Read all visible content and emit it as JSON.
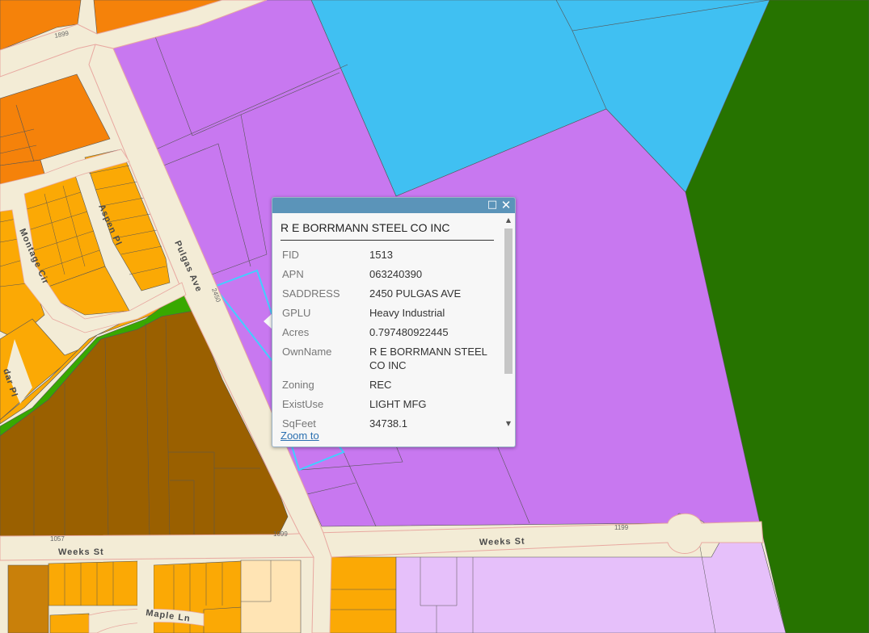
{
  "map": {
    "colors": {
      "purple_industrial": "#c878f0",
      "blue_zone": "#40c0f2",
      "dark_green": "#267300",
      "orange_commercial": "#f5820a",
      "yellow_orange_residential": "#fba905",
      "brown_zone": "#9a6000",
      "lavender_zone": "#e6c0fa",
      "light_tan": "#ffe4b4",
      "road": "#f3ecd6",
      "road_edge": "#e8a8a0",
      "green_strip": "#38a800",
      "selection": "#40d0ff"
    },
    "street_labels": {
      "pulgas_ave": "Pulgas Ave",
      "weeks_st_left": "Weeks St",
      "weeks_st_right": "Weeks St",
      "montage_cir": "Montage Cir",
      "aspen_pl": "Aspen Pl",
      "maple_ln": "Maple Ln",
      "cedar_pl": "dar Pl"
    },
    "address_labels": [
      "1899",
      "1057",
      "1099",
      "1199",
      "2450"
    ]
  },
  "popup": {
    "title": "R E BORRMANN STEEL CO INC",
    "maximize_icon": "maximize-icon",
    "close_icon": "close-icon",
    "fields": [
      {
        "key": "FID",
        "value": "1513"
      },
      {
        "key": "APN",
        "value": "063240390"
      },
      {
        "key": "SADDRESS",
        "value": "2450 PULGAS AVE"
      },
      {
        "key": "GPLU",
        "value": "Heavy Industrial"
      },
      {
        "key": "Acres",
        "value": "0.797480922445"
      },
      {
        "key": "OwnName",
        "value": "R E BORRMANN STEEL CO INC"
      },
      {
        "key": "Zoning",
        "value": "REC"
      },
      {
        "key": "ExistUse",
        "value": "LIGHT MFG"
      },
      {
        "key": "SqFeet",
        "value": "34738.1"
      }
    ],
    "zoom_link": "Zoom to"
  }
}
